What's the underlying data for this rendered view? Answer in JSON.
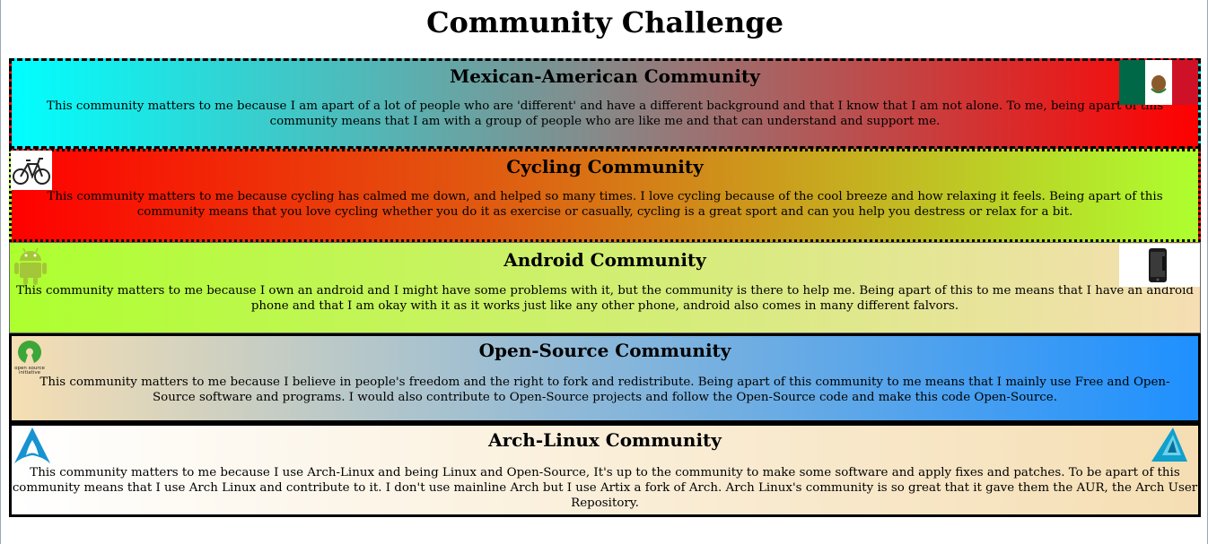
{
  "page": {
    "title": "Community Challenge"
  },
  "sections": [
    {
      "title": "Mexican-American Community",
      "text": "This community matters to me because I am apart of a lot of people who are 'different' and have a different background and that I know that I am not alone. To me, being apart of this community means that I am with a group of people who are like me and that can understand and support me.",
      "icon": "mexico-flag-icon"
    },
    {
      "title": "Cycling Community",
      "text": "This community matters to me because cycling has calmed me down, and helped so many times. I love cycling because of the cool breeze and how relaxing it feels. Being apart of this community means that you love cycling whether you do it as exercise or casually, cycling is a great sport and can you help you destress or relax for a bit.",
      "icon": "bicycle-icon"
    },
    {
      "title": "Android Community",
      "text": "This community matters to me because I own an android and I might have some problems with it, but the community is there to help me. Being apart of this to me means that I have an android phone and that I am okay with it as it works just like any other phone, android also comes in many different falvors.",
      "icons": [
        "android-robot-icon",
        "smartphone-icon"
      ]
    },
    {
      "title": "Open-Source Community",
      "text": "This community matters to me because I believe in people's freedom and the right to fork and redistribute. Being apart of this community to me means that I mainly use Free and Open-Source software and programs. I would also contribute to Open-Source projects and follow the Open-Source code and make this code Open-Source.",
      "icon": "open-source-initiative-logo-icon",
      "logo_text": [
        "open source",
        "initiative"
      ]
    },
    {
      "title": "Arch-Linux Community",
      "text": "This community matters to me because I use Arch-Linux and being Linux and Open-Source, It's up to the community to make some software and apply fixes and patches. To be apart of this community means that I use Arch Linux and contribute to it. I don't use mainline Arch but I use Artix a fork of Arch. Arch Linux's community is so great that it gave them the AUR, the Arch User Repository.",
      "icons": [
        "arch-linux-logo-icon",
        "artix-linux-logo-icon"
      ]
    }
  ],
  "colors": {
    "mexican_gradient": [
      "#00ffff",
      "#888888",
      "#ff0000"
    ],
    "cycling_gradient": [
      "#ff0000",
      "#adff2f"
    ],
    "android_gradient": [
      "#adff2f",
      "#f5deb3"
    ],
    "opensource_gradient": [
      "#f5deb3",
      "#1e90ff"
    ],
    "arch_gradient": [
      "#ffffff",
      "#f5deb3"
    ],
    "android_green": "#a4c639",
    "arch_blue": "#1793d1"
  }
}
